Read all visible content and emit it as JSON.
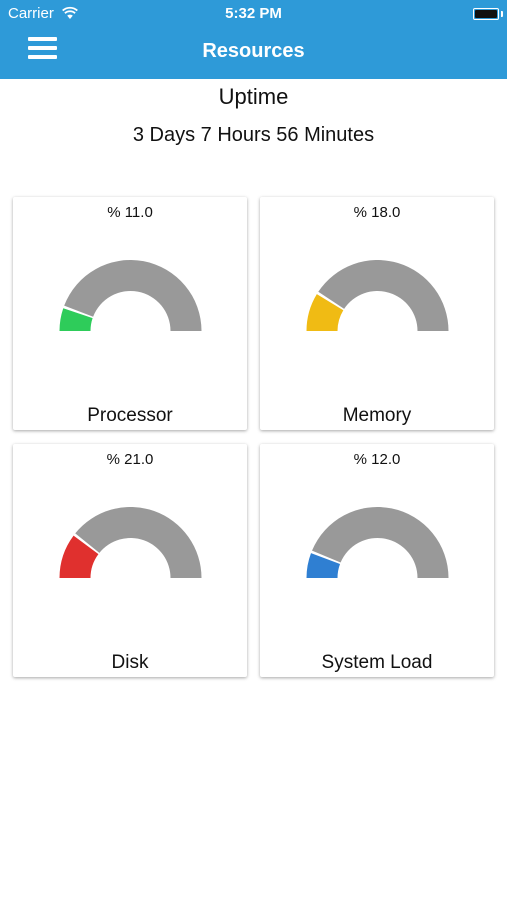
{
  "status_bar": {
    "carrier": "Carrier",
    "time": "5:32 PM",
    "wifi_icon": "wifi-icon",
    "battery_icon": "battery-icon"
  },
  "header": {
    "title": "Resources",
    "menu_icon": "hamburger-menu-icon",
    "background_color": "#2e9ad8"
  },
  "uptime": {
    "title": "Uptime",
    "value": "3 Days 7 Hours 56 Minutes"
  },
  "gauges": [
    {
      "label": "Processor",
      "percent_text": "% 11.0",
      "value": 11.0,
      "color": "#2ecc5a"
    },
    {
      "label": "Memory",
      "percent_text": "% 18.0",
      "value": 18.0,
      "color": "#f0bb14"
    },
    {
      "label": "Disk",
      "percent_text": "% 21.0",
      "value": 21.0,
      "color": "#e0302e"
    },
    {
      "label": "System Load",
      "percent_text": "% 12.0",
      "value": 12.0,
      "color": "#2f7fd2"
    }
  ],
  "gauge_track_color": "#999999"
}
